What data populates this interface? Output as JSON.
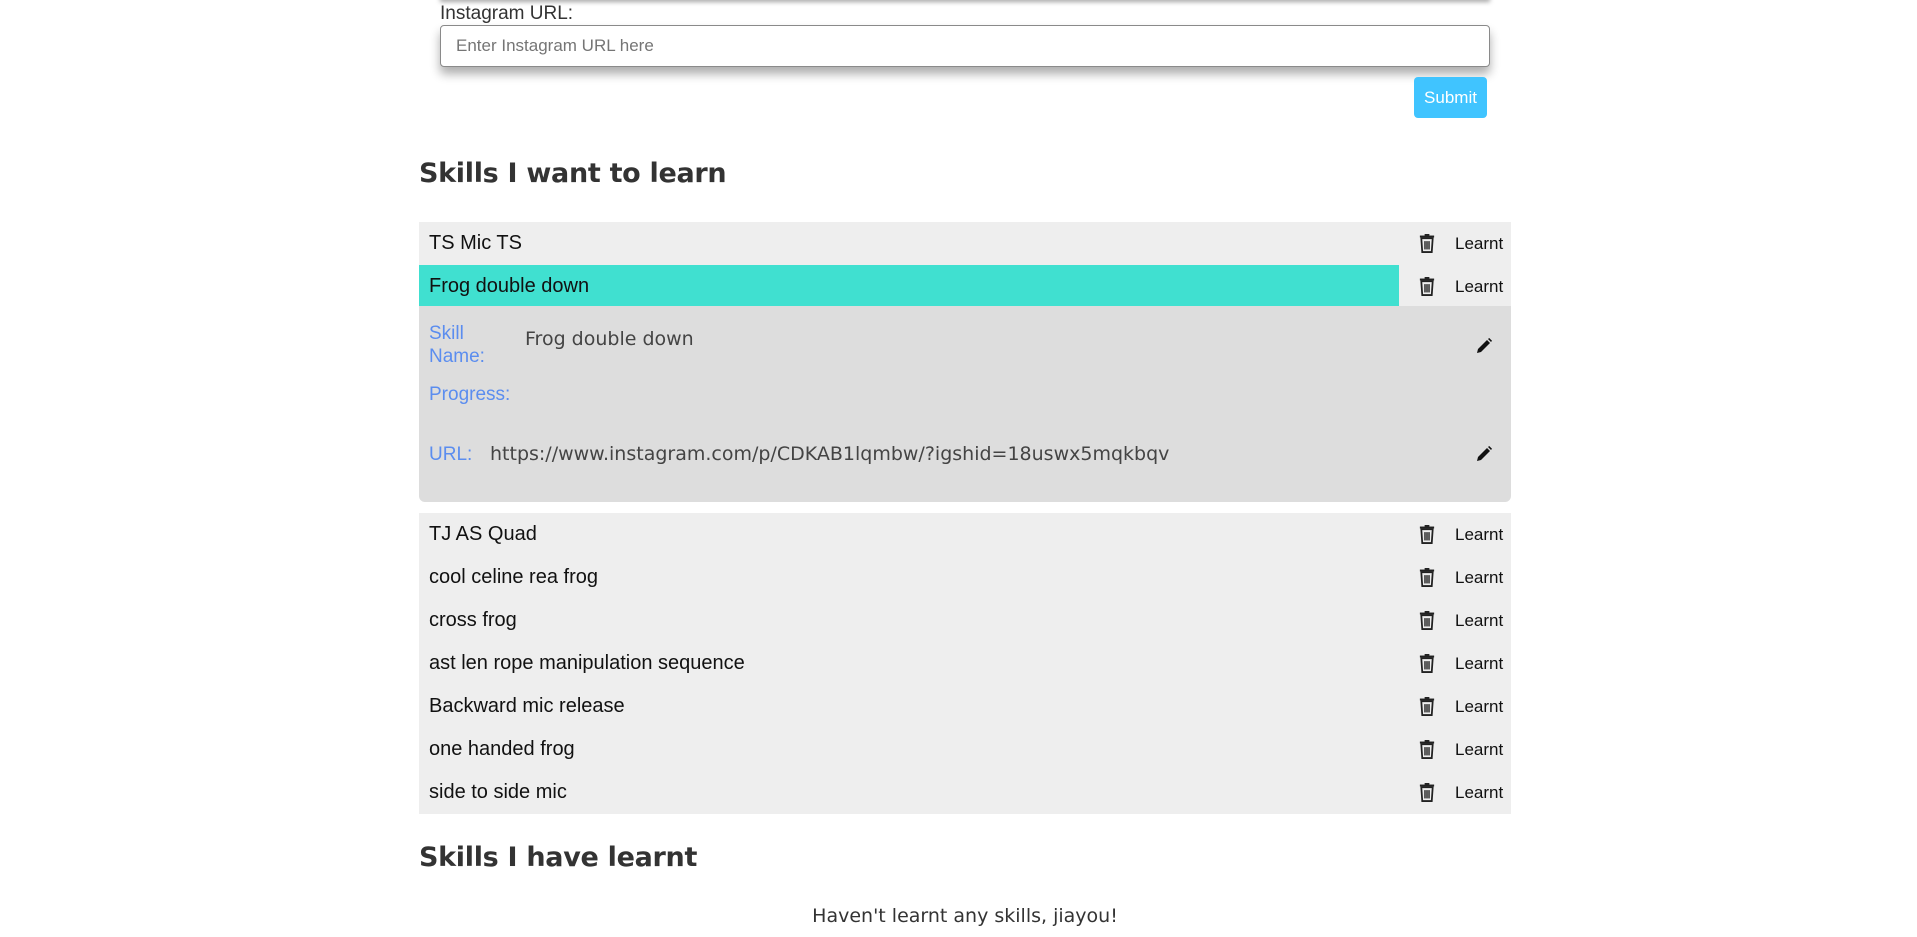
{
  "form": {
    "url_label": "Instagram URL:",
    "url_placeholder": "Enter Instagram URL here",
    "url_value": "",
    "submit_label": "Submit"
  },
  "want_section": {
    "heading": "Skills I want to learn",
    "learnt_label": "Learnt",
    "items": [
      {
        "name": "TS Mic TS"
      },
      {
        "name": "Frog double down",
        "active": true
      },
      {
        "name": "TJ AS Quad"
      },
      {
        "name": "cool celine rea frog"
      },
      {
        "name": "cross frog"
      },
      {
        "name": "ast len rope manipulation sequence"
      },
      {
        "name": "Backward mic release"
      },
      {
        "name": "one handed frog"
      },
      {
        "name": "side to side mic"
      }
    ],
    "details": {
      "skill_name_label": "Skill Name:",
      "skill_name_value": "Frog double down",
      "progress_label": "Progress:",
      "url_label": "URL:",
      "url_value": "https://www.instagram.com/p/CDKAB1lqmbw/?igshid=18uswx5mqkbqv"
    }
  },
  "learnt_section": {
    "heading": "Skills I have learnt",
    "empty_message": "Haven't learnt any skills, jiayou!"
  },
  "colors": {
    "submit_bg": "#40c4ff",
    "active_row_bg": "#40e0d0",
    "row_bg": "#eeeeee",
    "details_bg": "#dddddd",
    "detail_label": "#5b8def"
  },
  "icons": {
    "delete": "trash-icon",
    "edit": "pencil-icon"
  }
}
